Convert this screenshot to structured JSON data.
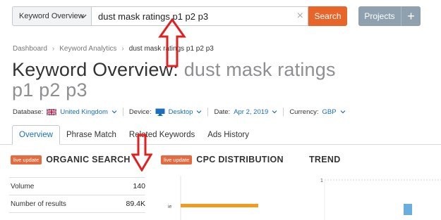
{
  "search": {
    "database_select_label": "Keyword Overview",
    "query": "dust mask ratings p1 p2 p3",
    "button_label": "Search"
  },
  "header": {
    "projects_label": "Projects",
    "add_label": "+"
  },
  "breadcrumb": {
    "items": [
      "Dashboard",
      "Keyword Analytics",
      "dust mask ratings p1 p2 p3"
    ]
  },
  "title": {
    "label": "Keyword Overview:",
    "query": "dust mask ratings p1 p2 p3"
  },
  "filters": {
    "database_label": "Database:",
    "database_value": "United Kingdom",
    "device_label": "Device:",
    "device_value": "Desktop",
    "date_label": "Date:",
    "date_value": "Apr 2, 2019",
    "currency_label": "Currency:",
    "currency_value": "GBP"
  },
  "tabs": [
    {
      "label": "Overview",
      "active": true
    },
    {
      "label": "Phrase Match",
      "active": false
    },
    {
      "label": "Related Keywords",
      "active": false
    },
    {
      "label": "Ads History",
      "active": false
    }
  ],
  "organic": {
    "badge": "live update",
    "title": "ORGANIC SEARCH",
    "rows": [
      {
        "label": "Volume",
        "value": "140"
      },
      {
        "label": "Number of results",
        "value": "89.4K"
      }
    ]
  },
  "cpc": {
    "badge": "live update",
    "title": "CPC DISTRIBUTION",
    "row_label": "ie"
  },
  "trend": {
    "title": "TREND",
    "axis_top": "1"
  },
  "colors": {
    "accent": "#e8652a",
    "link": "#1a6fbf",
    "badge": "#e56b3e",
    "projects": "#8fa1ae",
    "cpc_bar": "#f39c1b",
    "trend_bar": "#6aaee0",
    "annotation_arrow": "#e0211f"
  }
}
